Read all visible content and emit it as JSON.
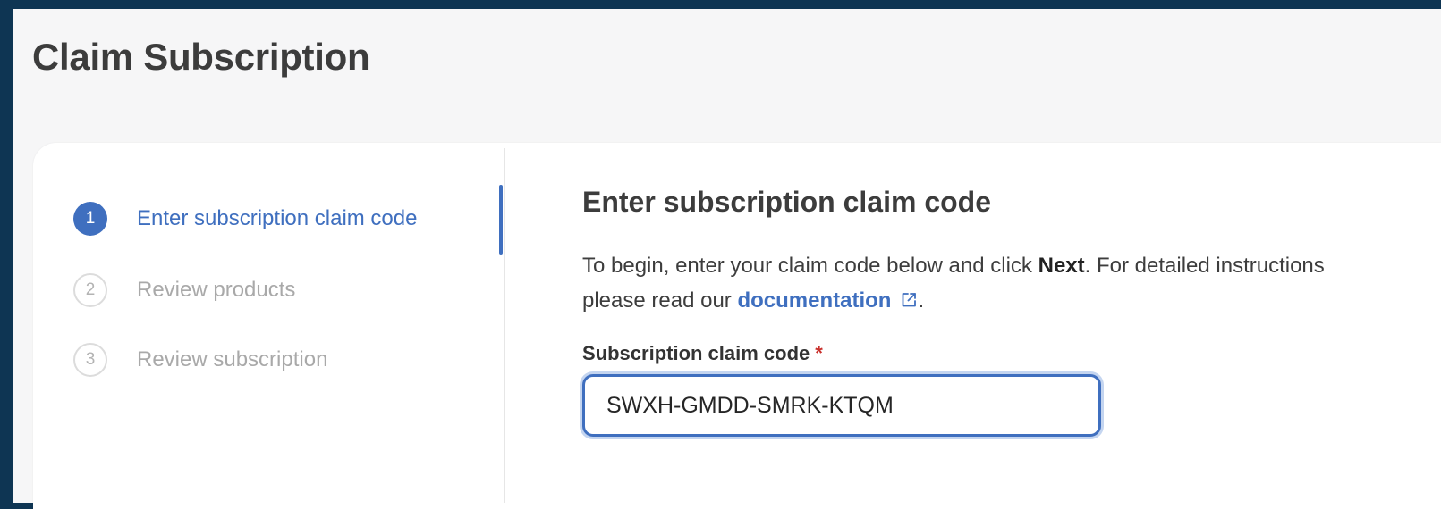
{
  "page": {
    "title": "Claim Subscription"
  },
  "stepper": {
    "steps": [
      {
        "number": "1",
        "label": "Enter subscription claim code",
        "state": "active"
      },
      {
        "number": "2",
        "label": "Review products",
        "state": "inactive"
      },
      {
        "number": "3",
        "label": "Review subscription",
        "state": "inactive"
      }
    ]
  },
  "content": {
    "section_title": "Enter subscription claim code",
    "description": {
      "line1_prefix": "To begin, enter your claim code below and click ",
      "line1_bold": "Next",
      "line1_suffix": ". For detailed instructions",
      "line2_prefix": "please read our ",
      "link_text": "documentation",
      "line2_suffix": "."
    },
    "field": {
      "label": "Subscription claim code",
      "required_marker": "*",
      "value": "SWXH-GMDD-SMRK-KTQM"
    }
  },
  "icons": {
    "documentation_link_icon": "external-link-icon"
  },
  "colors": {
    "accent": "#3f6fbf",
    "outer_background": "#0e3553",
    "page_background": "#f6f6f7",
    "required": "#c9302c"
  }
}
